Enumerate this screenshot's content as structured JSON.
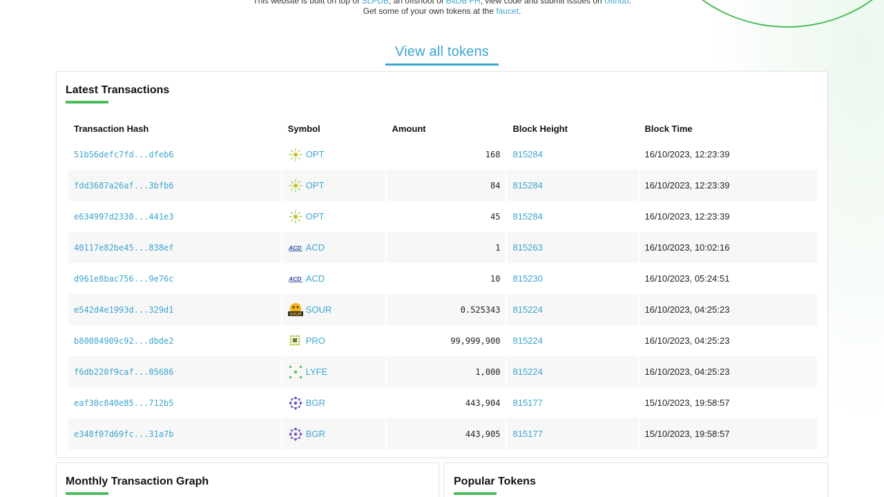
{
  "top": {
    "line1_pre": "This website is built on top of ",
    "link_slpdb": "SLPDB",
    "line1_mid": ", an offshoot of ",
    "link_bitdb": "BitDB FH",
    "line1_post": ", view code and submit issues on ",
    "link_github": "Github",
    "line1_end": ".",
    "line2_pre": "Get some of your own tokens at the ",
    "link_faucet": "faucet",
    "line2_end": "."
  },
  "view_all": "View all tokens",
  "transactions": {
    "title": "Latest Transactions",
    "headers": {
      "hash": "Transaction Hash",
      "symbol": "Symbol",
      "amount": "Amount",
      "block": "Block Height",
      "time": "Block Time"
    },
    "rows": [
      {
        "hash": "51b56defc7fd...dfeb6",
        "symbol": "OPT",
        "icon": "opt-icon",
        "amount": "168",
        "block": "815284",
        "time": "16/10/2023, 12:23:39"
      },
      {
        "hash": "fdd3687a26af...3bfb6",
        "symbol": "OPT",
        "icon": "opt-icon",
        "amount": "84",
        "block": "815284",
        "time": "16/10/2023, 12:23:39"
      },
      {
        "hash": "e634997d2330...441e3",
        "symbol": "OPT",
        "icon": "opt-icon",
        "amount": "45",
        "block": "815284",
        "time": "16/10/2023, 12:23:39"
      },
      {
        "hash": "40117e82be45...838ef",
        "symbol": "ACD",
        "icon": "acd-icon",
        "amount": "1",
        "block": "815263",
        "time": "16/10/2023, 10:02:16"
      },
      {
        "hash": "d961e8bac756...9e76c",
        "symbol": "ACD",
        "icon": "acd-icon",
        "amount": "10",
        "block": "815230",
        "time": "16/10/2023, 05:24:51"
      },
      {
        "hash": "e542d4e1993d...329d1",
        "symbol": "SOUR",
        "icon": "sour-icon",
        "amount": "0.525343",
        "block": "815224",
        "time": "16/10/2023, 04:25:23"
      },
      {
        "hash": "b80084909c92...dbde2",
        "symbol": "PRO",
        "icon": "pro-icon",
        "amount": "99,999,900",
        "block": "815224",
        "time": "16/10/2023, 04:25:23"
      },
      {
        "hash": "f6db220f9caf...05686",
        "symbol": "LYFE",
        "icon": "lyfe-icon",
        "amount": "1,000",
        "block": "815224",
        "time": "16/10/2023, 04:25:23"
      },
      {
        "hash": "eaf30c840e85...712b5",
        "symbol": "BGR",
        "icon": "bgr-icon",
        "amount": "443,904",
        "block": "815177",
        "time": "15/10/2023, 19:58:57"
      },
      {
        "hash": "e348f07d69fc...31a7b",
        "symbol": "BGR",
        "icon": "bgr-icon",
        "amount": "443,905",
        "block": "815177",
        "time": "15/10/2023, 19:58:57"
      }
    ]
  },
  "graph": {
    "title": "Monthly Transaction Graph"
  },
  "popular": {
    "title": "Popular Tokens"
  },
  "colors": {
    "accent": "#3ba5cf",
    "green": "#4cbb5e"
  },
  "icons": {
    "opt-icon": "<svg viewBox='0 0 22 22'><circle cx='11' cy='11' r='3' fill='#c9c028'/><g stroke='#a8d96a' stroke-width='1.4' stroke-linecap='round'><line x1='11' y1='2' x2='11' y2='6'/><line x1='11' y1='16' x2='11' y2='20'/><line x1='2' y1='11' x2='6' y2='11'/><line x1='16' y1='11' x2='20' y2='11'/><line x1='4.5' y1='4.5' x2='7' y2='7'/><line x1='15' y1='15' x2='17.5' y2='17.5'/><line x1='4.5' y1='17.5' x2='7' y2='15'/><line x1='15' y1='7' x2='17.5' y2='4.5'/></g></svg>",
    "acd-icon": "<svg viewBox='0 0 22 22'><text x='1' y='14' font-family='Liberation Sans, sans-serif' font-size='8.5' font-weight='bold' font-style='italic' fill='#2b4fa0'>ACD</text><line x1='1' y1='15.5' x2='21' y2='15.5' stroke='#2b4fa0' stroke-width='1'/></svg>",
    "sour-icon": "<svg viewBox='0 0 22 22'><circle cx='11' cy='9' r='8' fill='#f2b31a'/><circle cx='8' cy='7' r='1.4' fill='#3a2a00'/><circle cx='14' cy='7' r='1.4' fill='#3a2a00'/><rect x='0' y='13' width='22' height='7' rx='1' fill='#2a2a2a'/><text x='11' y='19' text-anchor='middle' font-family='Liberation Sans, sans-serif' font-size='6' font-weight='bold' fill='#f2b31a'>SOUR</text></svg>",
    "pro-icon": "<svg viewBox='0 0 22 22'><g fill='#b3c94a'><circle cx='4' cy='4' r='1.5'/><circle cx='8' cy='4' r='1.5'/><circle cx='12' cy='4' r='1.5'/><circle cx='16' cy='4' r='1.5'/><circle cx='4' cy='8' r='1.5'/><circle cx='16' cy='8' r='1.5'/><circle cx='4' cy='12' r='1.5'/><circle cx='16' cy='12' r='1.5'/><circle cx='4' cy='16' r='1.5'/><circle cx='8' cy='16' r='1.5'/><circle cx='12' cy='16' r='1.5'/><circle cx='16' cy='16' r='1.5'/></g><rect x='7' y='7' width='6' height='6' fill='#6a7a2a'/></svg>",
    "lyfe-icon": "<svg viewBox='0 0 22 22'><g fill='#5bc46a'><rect x='2' y='2' width='3' height='3'/><rect x='17' y='2' width='3' height='3'/><rect x='2' y='17' width='3' height='3'/><rect x='17' y='17' width='3' height='3'/><circle cx='11' cy='11' r='2.2'/></g></svg>",
    "bgr-icon": "<svg viewBox='0 0 22 22'><g fill='#6a4fb8'><polygon points='11,1 14,5 8,5'/><polygon points='11,21 14,17 8,17'/><polygon points='1,11 5,8 5,14'/><polygon points='21,11 17,8 17,14'/><polygon points='4,4 8,5 5,8'/><polygon points='18,4 14,5 17,8'/><polygon points='4,18 8,17 5,14'/><polygon points='18,18 14,17 17,14'/><circle cx='11' cy='11' r='2.2'/></g></svg>"
  }
}
